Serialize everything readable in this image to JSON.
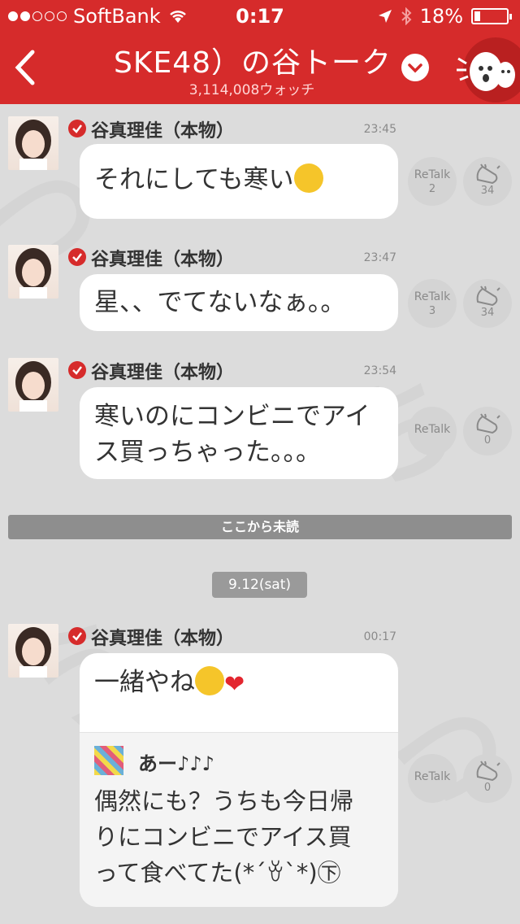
{
  "status_bar": {
    "carrier": "SoftBank",
    "time": "0:17",
    "battery": "18%",
    "battery_level": 0.18
  },
  "nav": {
    "title": "SKE48）の谷トーク",
    "watchers": "3,114,008ウォッチ"
  },
  "messages": [
    {
      "name": "谷真理佳（本物）",
      "time": "23:45",
      "text": "それにしても寒い",
      "retalk_label": "ReTalk",
      "retalk_count": "2",
      "clap_count": "34"
    },
    {
      "name": "谷真理佳（本物）",
      "time": "23:47",
      "text": "星、、でてないなぁ。。",
      "retalk_label": "ReTalk",
      "retalk_count": "3",
      "clap_count": "34"
    },
    {
      "name": "谷真理佳（本物）",
      "time": "23:54",
      "text_line1": "寒いのにコンビニでアイ",
      "text_line2": "ス買っちゃった。。。",
      "retalk_label": "ReTalk",
      "clap_count": "0"
    }
  ],
  "unread_divider": "ここから未読",
  "date_divider": "9.12(sat)",
  "reply": {
    "name": "谷真理佳（本物）",
    "time": "00:17",
    "text": "一緒やね",
    "retalk_label": "ReTalk",
    "clap_count": "0",
    "quote": {
      "name": "あー♪♪♪",
      "line1": "偶然にも？うちも今日帰",
      "line2": "りにコンビニでアイス買",
      "line3": "って食べてた(*´ꈊ`*)㊦"
    }
  },
  "colors": {
    "brand_red": "#d62b2b",
    "background": "#dcdcdc"
  }
}
